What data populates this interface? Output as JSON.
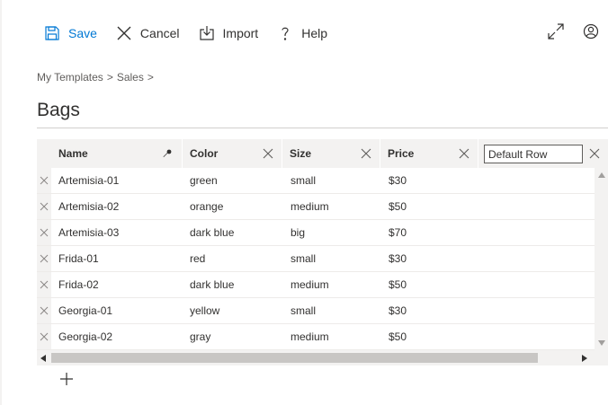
{
  "toolbar": {
    "save_label": "Save",
    "cancel_label": "Cancel",
    "import_label": "Import",
    "help_label": "Help",
    "save_icon": "save-icon",
    "cancel_icon": "close-icon",
    "import_icon": "import-icon",
    "help_icon": "question-icon",
    "expand_icon": "expand-icon",
    "user_icon": "user-icon",
    "accent_color": "#0078d4"
  },
  "breadcrumb": {
    "items": [
      "My Templates",
      ">",
      "Sales",
      ">"
    ]
  },
  "page": {
    "title": "Bags"
  },
  "grid": {
    "columns": [
      {
        "label": "Name",
        "action_icon": "pin-icon"
      },
      {
        "label": "Color",
        "action_icon": "close-icon"
      },
      {
        "label": "Size",
        "action_icon": "close-icon"
      },
      {
        "label": "Price",
        "action_icon": "close-icon"
      }
    ],
    "new_column_input": {
      "value": "Default Row"
    },
    "rows": [
      {
        "name": "Artemisia-01",
        "color": "green",
        "size": "small",
        "price": "$30"
      },
      {
        "name": "Artemisia-02",
        "color": "orange",
        "size": "medium",
        "price": "$50"
      },
      {
        "name": "Artemisia-03",
        "color": "dark blue",
        "size": "big",
        "price": "$70"
      },
      {
        "name": "Frida-01",
        "color": "red",
        "size": "small",
        "price": "$30"
      },
      {
        "name": "Frida-02",
        "color": "dark blue",
        "size": "medium",
        "price": "$50"
      },
      {
        "name": "Georgia-01",
        "color": "yellow",
        "size": "small",
        "price": "$30"
      },
      {
        "name": "Georgia-02",
        "color": "gray",
        "size": "medium",
        "price": "$50"
      }
    ],
    "add_row_icon": "plus-icon"
  }
}
